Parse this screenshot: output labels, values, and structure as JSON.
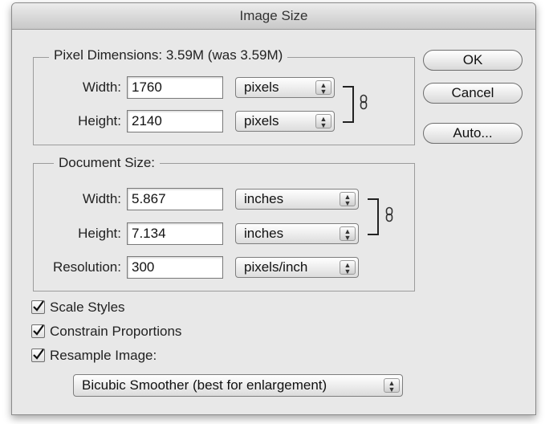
{
  "window": {
    "title": "Image Size"
  },
  "pixel_dimensions": {
    "title": "Pixel Dimensions:  3.59M (was 3.59M)",
    "width_label": "Width:",
    "width_value": "1760",
    "width_unit": "pixels",
    "height_label": "Height:",
    "height_value": "2140",
    "height_unit": "pixels"
  },
  "document_size": {
    "title": "Document Size:",
    "width_label": "Width:",
    "width_value": "5.867",
    "width_unit": "inches",
    "height_label": "Height:",
    "height_value": "7.134",
    "height_unit": "inches",
    "resolution_label": "Resolution:",
    "resolution_value": "300",
    "resolution_unit": "pixels/inch"
  },
  "buttons": {
    "ok": "OK",
    "cancel": "Cancel",
    "auto": "Auto..."
  },
  "options": {
    "scale_styles": "Scale Styles",
    "scale_styles_checked": true,
    "constrain_proportions": "Constrain Proportions",
    "constrain_proportions_checked": true,
    "resample_image": "Resample Image:",
    "resample_image_checked": true,
    "resample_method": "Bicubic Smoother (best for enlargement)"
  },
  "icons": {
    "stepper": "up-down-arrows-icon",
    "link": "chain-link-icon",
    "check": "checkmark-icon"
  }
}
